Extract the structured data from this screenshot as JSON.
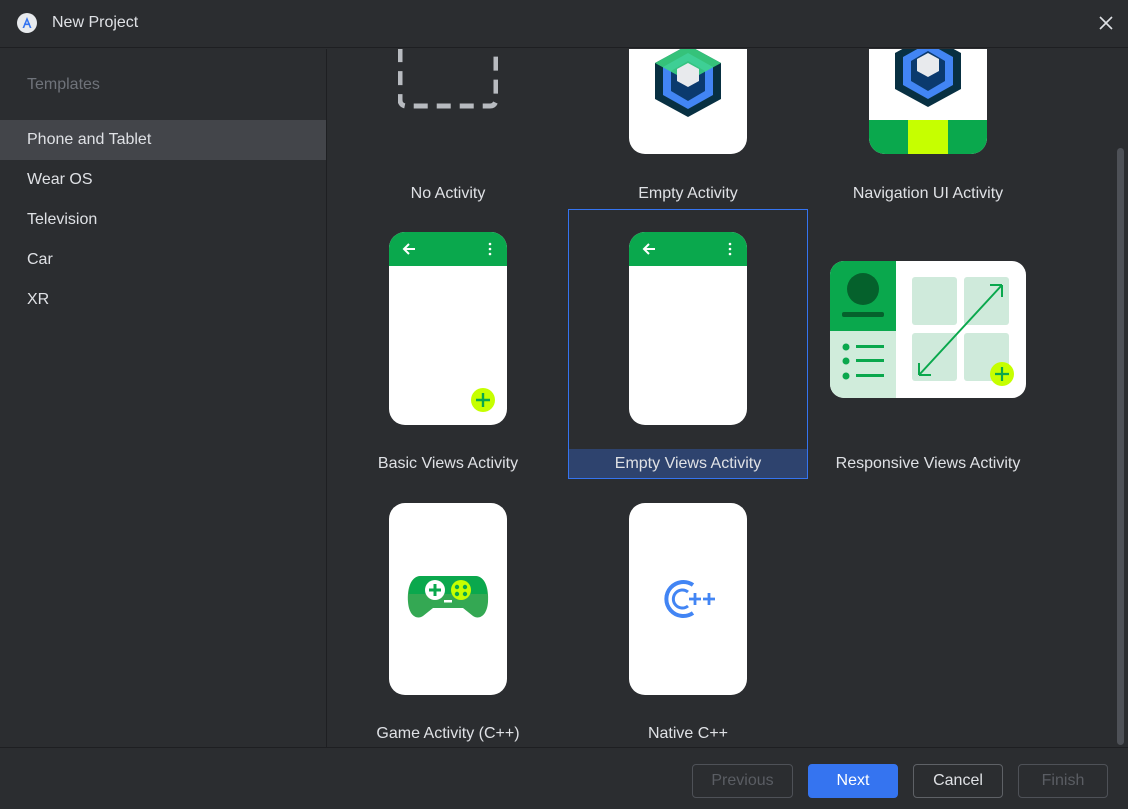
{
  "window": {
    "title": "New Project"
  },
  "sidebar": {
    "header": "Templates",
    "items": [
      {
        "label": "Phone and Tablet",
        "selected": true
      },
      {
        "label": "Wear OS"
      },
      {
        "label": "Television"
      },
      {
        "label": "Car"
      },
      {
        "label": "XR"
      }
    ]
  },
  "templates": [
    {
      "label": "No Activity"
    },
    {
      "label": "Empty Activity"
    },
    {
      "label": "Navigation UI Activity"
    },
    {
      "label": "Basic Views Activity"
    },
    {
      "label": "Empty Views Activity",
      "selected": true
    },
    {
      "label": "Responsive Views Activity"
    },
    {
      "label": "Game Activity (C++)"
    },
    {
      "label": "Native C++"
    }
  ],
  "footer": {
    "previous": "Previous",
    "next": "Next",
    "cancel": "Cancel",
    "finish": "Finish"
  },
  "colors": {
    "accent": "#3574f0",
    "green": "#0aa84d",
    "lime": "#c6ff00",
    "selection": "#2e436e"
  }
}
